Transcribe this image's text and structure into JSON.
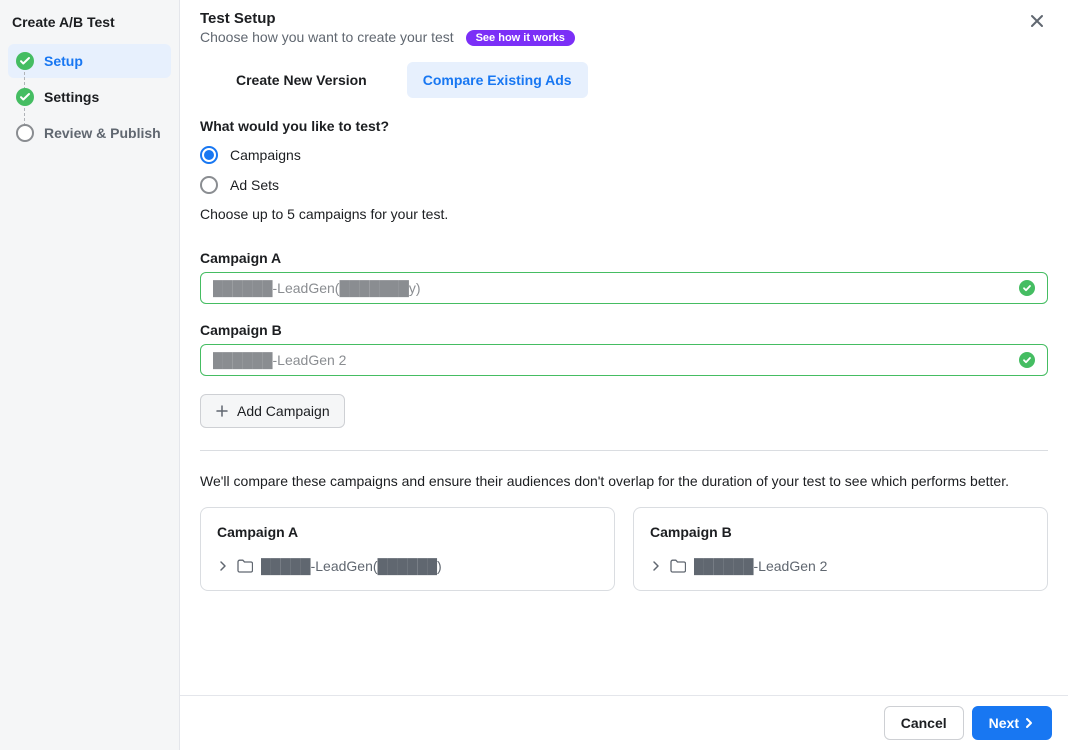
{
  "sidebar": {
    "title": "Create A/B Test",
    "steps": [
      {
        "label": "Setup",
        "status": "done",
        "active": true
      },
      {
        "label": "Settings",
        "status": "done",
        "active": false
      },
      {
        "label": "Review & Publish",
        "status": "pending",
        "active": false
      }
    ]
  },
  "header": {
    "title": "Test Setup",
    "subtitle": "Choose how you want to create your test",
    "pill": "See how it works"
  },
  "tabs": [
    {
      "label": "Create New Version",
      "active": false
    },
    {
      "label": "Compare Existing Ads",
      "active": true
    }
  ],
  "question": {
    "label": "What would you like to test?",
    "options": [
      {
        "label": "Campaigns",
        "selected": true
      },
      {
        "label": "Ad Sets",
        "selected": false
      }
    ],
    "help": "Choose up to 5 campaigns for your test."
  },
  "campaigns": [
    {
      "heading": "Campaign A",
      "value": "██████-LeadGen(███████y)"
    },
    {
      "heading": "Campaign B",
      "value": "██████-LeadGen 2"
    }
  ],
  "add_campaign_label": "Add Campaign",
  "compare_desc": "We'll compare these campaigns and ensure their audiences don't overlap for the duration of your test to see which performs better.",
  "cards": [
    {
      "title": "Campaign A",
      "item": "█████-LeadGen(██████)"
    },
    {
      "title": "Campaign B",
      "item": "██████-LeadGen 2"
    }
  ],
  "footer": {
    "cancel": "Cancel",
    "next": "Next"
  }
}
